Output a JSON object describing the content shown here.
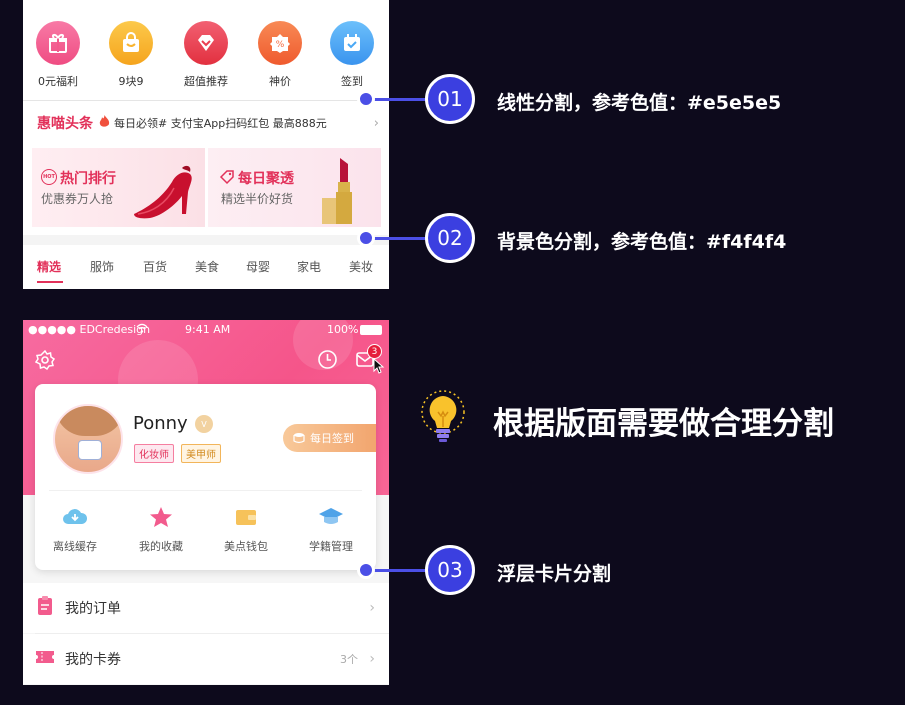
{
  "top_panel": {
    "icons": [
      {
        "label": "0元福利",
        "color": "#f25b8d",
        "icon": "gift-icon"
      },
      {
        "label": "9块9",
        "color": "#f9b42f",
        "icon": "shopping-bag-icon"
      },
      {
        "label": "超值推荐",
        "color": "#ea3f51",
        "icon": "diamond-icon"
      },
      {
        "label": "神价",
        "color": "#f5693d",
        "icon": "discount-tag-icon"
      },
      {
        "label": "签到",
        "color": "#4aa8f5",
        "icon": "calendar-check-icon"
      }
    ],
    "news": {
      "brand": "惠喵头条",
      "text": "每日必领# 支付宝App扫码红包  最高888元"
    },
    "cards": [
      {
        "title": "热门排行",
        "badge": "HOT",
        "subtitle": "优惠券万人抢"
      },
      {
        "title": "每日聚透",
        "subtitle": "精选半价好货"
      }
    ],
    "tabs": [
      "精选",
      "服饰",
      "百货",
      "美食",
      "母婴",
      "家电",
      "美妆"
    ],
    "active_tab": "精选"
  },
  "bottom_panel": {
    "status_bar": {
      "carrier": "●●●●● EDCredesign",
      "time": "9:41 AM",
      "battery": "100%"
    },
    "notification_count": "3",
    "profile": {
      "name": "Ponny",
      "tags": [
        "化妆师",
        "美甲师"
      ],
      "checkin_label": "每日签到"
    },
    "quick_actions": [
      {
        "label": "离线缓存",
        "icon": "cloud-download-icon"
      },
      {
        "label": "我的收藏",
        "icon": "star-icon"
      },
      {
        "label": "美点钱包",
        "icon": "wallet-icon"
      },
      {
        "label": "学籍管理",
        "icon": "graduation-cap-icon"
      }
    ],
    "list": [
      {
        "label": "我的订单",
        "extra": "",
        "icon": "order-icon"
      },
      {
        "label": "我的卡券",
        "extra": "3个",
        "icon": "ticket-icon"
      }
    ]
  },
  "callouts": [
    {
      "number": "01",
      "text": "线性分割，参考色值：#e5e5e5"
    },
    {
      "number": "02",
      "text": "背景色分割，参考色值：#f4f4f4"
    },
    {
      "number": "03",
      "text": "浮层卡片分割"
    }
  ],
  "headline": "根据版面需要做合理分割",
  "colors": {
    "accent": "#e2315a",
    "callout_blue": "#3b3fe0",
    "background": "#0d0a1c"
  }
}
